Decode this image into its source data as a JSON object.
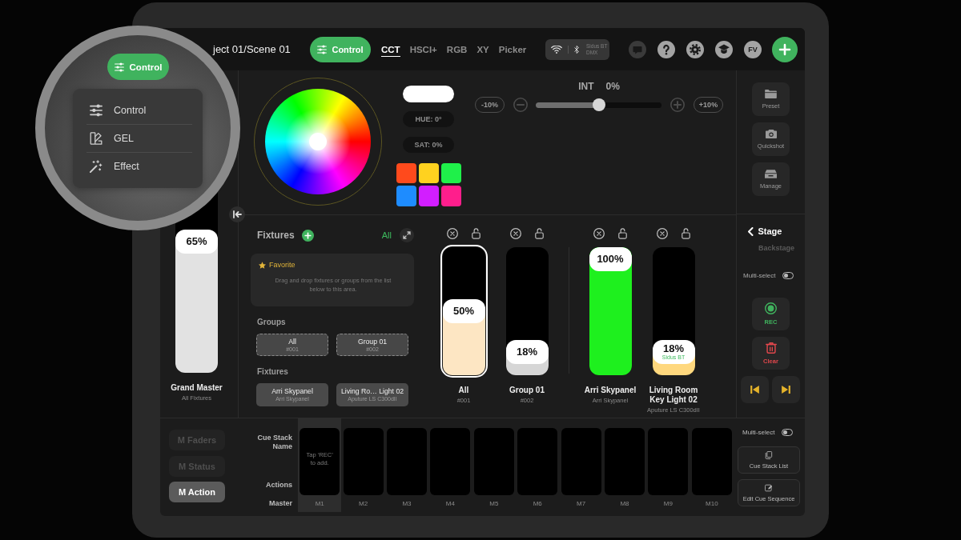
{
  "top_bar": {
    "title": "ject 01/Scene 01",
    "mode_button": "Control",
    "tabs": [
      {
        "label": "CCT",
        "selected": true
      },
      {
        "label": "HSCI+",
        "selected": false
      },
      {
        "label": "RGB",
        "selected": false
      },
      {
        "label": "XY",
        "selected": false
      },
      {
        "label": "Picker",
        "selected": false
      }
    ],
    "connection": [
      "Sidus BT",
      "DMX"
    ],
    "profile": "FV"
  },
  "magnifier": {
    "button": "Control",
    "menu": [
      {
        "label": "Control"
      },
      {
        "label": "GEL"
      },
      {
        "label": "Effect"
      }
    ]
  },
  "grand_master": {
    "reading": "65%",
    "level": 0.65,
    "name": "Grand Master",
    "subtitle": "All Fixtures"
  },
  "color": {
    "hue": "HUE: 0°",
    "saturation": "SAT: 0%",
    "swatches": [
      {
        "color": "#ff4a1c"
      },
      {
        "color": "#ffd21f"
      },
      {
        "color": "#1ff04a"
      },
      {
        "color": "#1e8cff"
      },
      {
        "color": "#d21eff"
      },
      {
        "color": "#ff1e8c"
      }
    ]
  },
  "intensity": {
    "label": "INT",
    "value": "0%",
    "decrease": "-10%",
    "increase": "+10%",
    "level": 0.5
  },
  "fixtures_panel": {
    "title": "Fixtures",
    "filter": "All",
    "favorite": {
      "title": "Favorite",
      "hint": "Drag and drop fixtures or groups from the list below to this area."
    },
    "groups_label": "Groups",
    "groups": [
      {
        "name": "All",
        "id": "#001"
      },
      {
        "name": "Group 01",
        "id": "#002"
      }
    ],
    "fixtures_label": "Fixtures",
    "fixtures": [
      {
        "name": "Arri Skypanel",
        "model": "Arri Skypanel"
      },
      {
        "name": "Living Ro… Light 02",
        "model": "Aputure LS C300dII"
      }
    ]
  },
  "group_faders": [
    {
      "name": "All",
      "subtitle": "#001",
      "reading": "50%",
      "level": 0.5,
      "color": "#fde6c3",
      "selected": true
    },
    {
      "name": "Group 01",
      "subtitle": "#002",
      "reading": "18%",
      "level": 0.18,
      "color": "#d6d6d6",
      "selected": false
    }
  ],
  "fixture_faders": [
    {
      "name": "Arri Skypanel",
      "subtitle": "Arri Skypanel",
      "reading": "100%",
      "level": 1,
      "color": "#1ef01e",
      "selected": false
    },
    {
      "name": "Living Room Key Light 02",
      "subtitle": "Aputure LS C300dII",
      "reading": "18%",
      "tag": "Sidus BT",
      "level": 0.18,
      "color": "#ffd87e",
      "selected": false
    }
  ],
  "side_panel": {
    "tools": [
      {
        "label": "Preset"
      },
      {
        "label": "Quickshot"
      },
      {
        "label": "Manage"
      }
    ],
    "stage": "Stage",
    "substage": "Backstage",
    "multi_select": {
      "label": "Multi-select",
      "on": false
    },
    "record": "REC",
    "clear": "Clear"
  },
  "cue_bar": {
    "modes": [
      {
        "label": "M Faders",
        "selected": false
      },
      {
        "label": "M Status",
        "selected": false
      },
      {
        "label": "M Action",
        "selected": true
      }
    ],
    "row_labels": [
      "Cue Stack Name",
      "Actions",
      "Master"
    ],
    "slots": [
      {
        "label": "M1",
        "selected": true,
        "hint": "Tap ‘REC’ to add."
      },
      {
        "label": "M2",
        "selected": false
      },
      {
        "label": "M3",
        "selected": false
      },
      {
        "label": "M4",
        "selected": false
      },
      {
        "label": "M5",
        "selected": false
      },
      {
        "label": "M6",
        "selected": false
      },
      {
        "label": "M7",
        "selected": false
      },
      {
        "label": "M8",
        "selected": false
      },
      {
        "label": "M9",
        "selected": false
      },
      {
        "label": "M10",
        "selected": false
      }
    ],
    "multi_select": {
      "label": "Multi-select",
      "on": false
    },
    "actions": [
      {
        "label": "Cue Stack List"
      },
      {
        "label": "Edit Cue Sequence"
      }
    ]
  }
}
